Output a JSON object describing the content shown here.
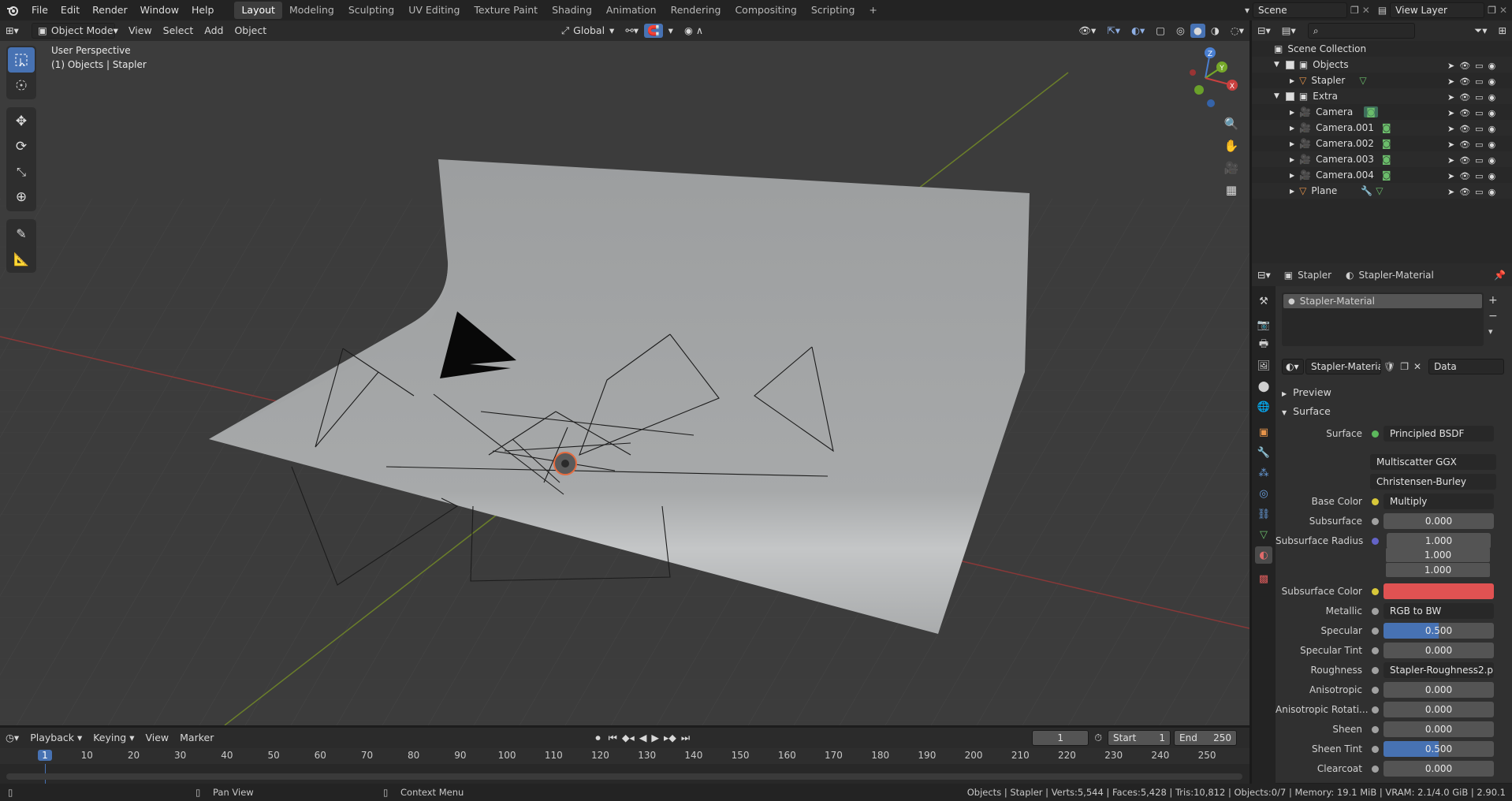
{
  "topbar": {
    "menus": [
      "File",
      "Edit",
      "Render",
      "Window",
      "Help"
    ],
    "workspaces": [
      "Layout",
      "Modeling",
      "Sculpting",
      "UV Editing",
      "Texture Paint",
      "Shading",
      "Animation",
      "Rendering",
      "Compositing",
      "Scripting"
    ],
    "active_workspace": "Layout",
    "add_tab": "+",
    "scene": "Scene",
    "view_layer": "View Layer"
  },
  "viewport_header": {
    "mode": "Object Mode",
    "menus": [
      "View",
      "Select",
      "Add",
      "Object"
    ],
    "orientation": "Global"
  },
  "viewport": {
    "perspective": "User Perspective",
    "context": "(1) Objects | Stapler",
    "gizmo_axes": [
      "Z",
      "Y",
      "X"
    ]
  },
  "outliner": {
    "search_placeholder": "",
    "rows": [
      {
        "label": "Scene Collection",
        "icon": "collection-icon"
      },
      {
        "label": "Objects",
        "icon": "collection-icon"
      },
      {
        "label": "Stapler",
        "icon": "mesh-icon"
      },
      {
        "label": "Extra",
        "icon": "collection-icon"
      },
      {
        "label": "Camera",
        "icon": "camera-icon"
      },
      {
        "label": "Camera.001",
        "icon": "camera-icon"
      },
      {
        "label": "Camera.002",
        "icon": "camera-icon"
      },
      {
        "label": "Camera.003",
        "icon": "camera-icon"
      },
      {
        "label": "Camera.004",
        "icon": "camera-icon"
      },
      {
        "label": "Plane",
        "icon": "mesh-icon"
      }
    ]
  },
  "properties": {
    "breadcrumb_object": "Stapler",
    "breadcrumb_material": "Stapler-Material",
    "slot_name": "Stapler-Material",
    "material_name": "Stapler-Material",
    "link": "Data",
    "sections": {
      "preview": "Preview",
      "surface": "Surface"
    },
    "rows": {
      "surface": {
        "label": "Surface",
        "value": "Principled BSDF"
      },
      "distribution": "Multiscatter GGX",
      "subsurface_method": "Christensen-Burley",
      "base_color": {
        "label": "Base Color",
        "value": "Multiply"
      },
      "subsurface": {
        "label": "Subsurface",
        "value": "0.000"
      },
      "subsurface_radius": {
        "label": "Subsurface Radius",
        "values": [
          "1.000",
          "1.000",
          "1.000"
        ]
      },
      "subsurface_color": {
        "label": "Subsurface Color",
        "color": "#e05252"
      },
      "metallic": {
        "label": "Metallic",
        "value": "RGB to BW"
      },
      "specular": {
        "label": "Specular",
        "value": "0.500",
        "fraction": 0.5
      },
      "specular_tint": {
        "label": "Specular Tint",
        "value": "0.000"
      },
      "roughness": {
        "label": "Roughness",
        "value": "Stapler-Roughness2.png"
      },
      "anisotropic": {
        "label": "Anisotropic",
        "value": "0.000"
      },
      "anisotropic_rotation": {
        "label": "Anisotropic Rotati...",
        "value": "0.000"
      },
      "sheen": {
        "label": "Sheen",
        "value": "0.000"
      },
      "sheen_tint": {
        "label": "Sheen Tint",
        "value": "0.500",
        "fraction": 0.5
      },
      "clearcoat": {
        "label": "Clearcoat",
        "value": "0.000"
      }
    }
  },
  "timeline": {
    "menus": [
      "Playback",
      "Keying",
      "View",
      "Marker"
    ],
    "current_frame": "1",
    "start_label": "Start",
    "start": "1",
    "end_label": "End",
    "end": "250",
    "ticks": [
      "1",
      "10",
      "20",
      "30",
      "40",
      "50",
      "60",
      "70",
      "80",
      "90",
      "100",
      "110",
      "120",
      "130",
      "140",
      "150",
      "160",
      "170",
      "180",
      "190",
      "200",
      "210",
      "220",
      "230",
      "240",
      "250"
    ]
  },
  "status": {
    "pan": "Pan View",
    "context_menu": "Context Menu",
    "stats": "Objects | Stapler | Verts:5,544 | Faces:5,428 | Tris:10,812 | Objects:0/7 | Memory: 19.1 MiB | VRAM: 2.1/4.0 GiB | 2.90.1"
  },
  "colors": {
    "accent": "#4772b3",
    "red_axis": "#9a3a3a",
    "green_axis": "#6b8e23",
    "subsurface_color": "#e05252"
  }
}
